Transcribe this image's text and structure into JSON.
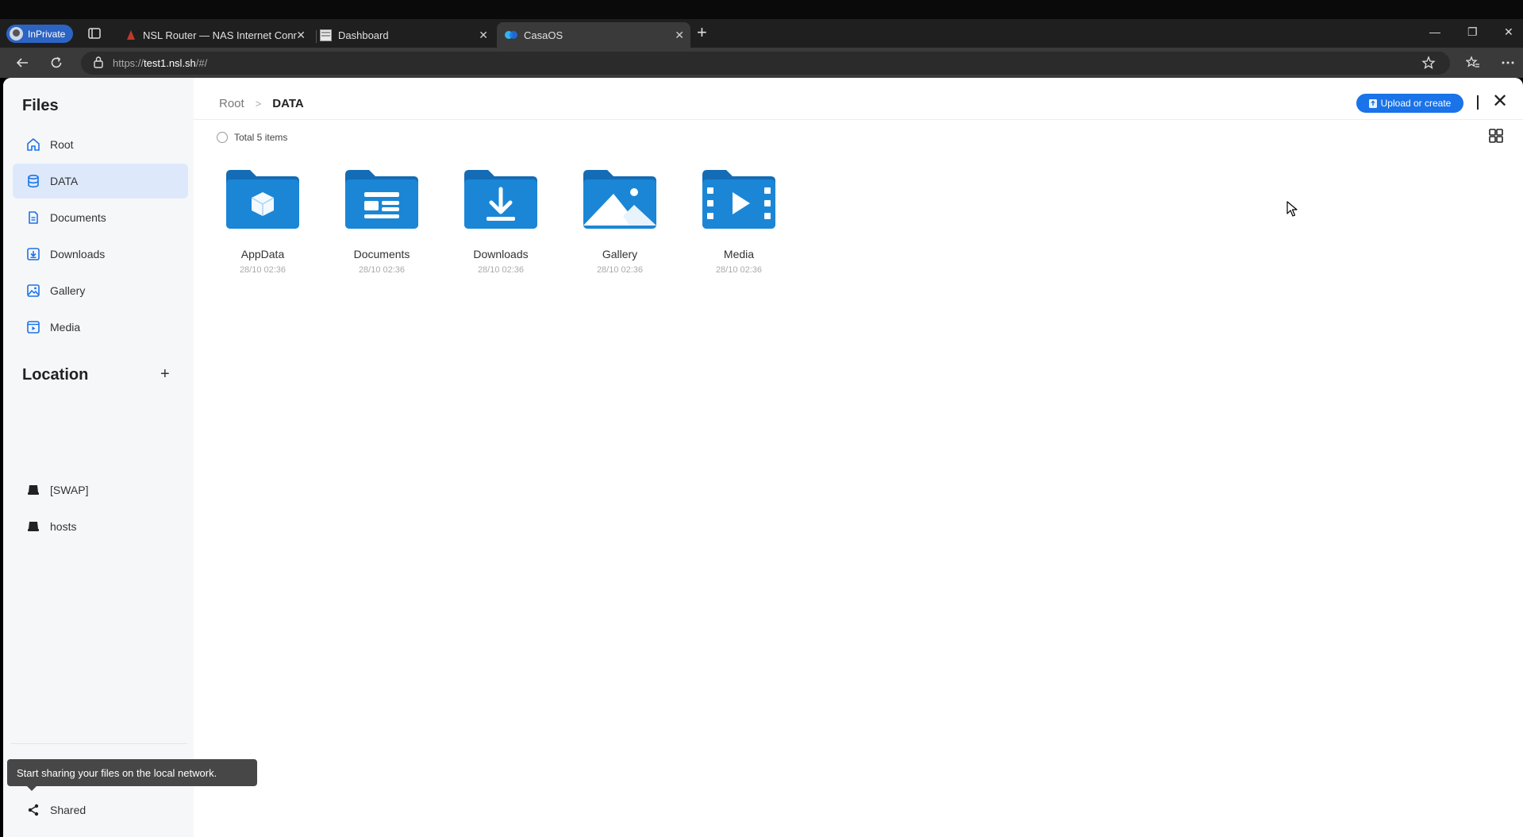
{
  "browser": {
    "inprivate_label": "InPrivate",
    "tabs": [
      {
        "label": "NSL Router — NAS Internet Conr",
        "icon": "router-favicon"
      },
      {
        "label": "Dashboard",
        "icon": "dashboard-favicon"
      },
      {
        "label": "CasaOS",
        "icon": "casaos-favicon",
        "active": true
      }
    ],
    "url_prefix": "https://",
    "url_host": "test1.nsl.sh",
    "url_path": "/#/"
  },
  "sidebar": {
    "title": "Files",
    "items": [
      {
        "label": "Root",
        "icon": "home-icon"
      },
      {
        "label": "DATA",
        "icon": "database-icon",
        "active": true
      },
      {
        "label": "Documents",
        "icon": "document-icon"
      },
      {
        "label": "Downloads",
        "icon": "download-icon"
      },
      {
        "label": "Gallery",
        "icon": "image-icon"
      },
      {
        "label": "Media",
        "icon": "video-icon"
      }
    ],
    "location_title": "Location",
    "locations": [
      {
        "label": "[SWAP]",
        "icon": "drive-icon"
      },
      {
        "label": "hosts",
        "icon": "drive-icon"
      }
    ],
    "tooltip": "Start sharing your files on the local network.",
    "shared_label": "Shared"
  },
  "main": {
    "breadcrumb": [
      "Root",
      "DATA"
    ],
    "breadcrumb_sep": ">",
    "upload_label": "Upload or create",
    "total_label": "Total 5 items",
    "folders": [
      {
        "name": "AppData",
        "date": "28/10 02:36",
        "icon": "cube-folder-icon"
      },
      {
        "name": "Documents",
        "date": "28/10 02:36",
        "icon": "document-folder-icon"
      },
      {
        "name": "Downloads",
        "date": "28/10 02:36",
        "icon": "download-folder-icon"
      },
      {
        "name": "Gallery",
        "date": "28/10 02:36",
        "icon": "gallery-folder-icon"
      },
      {
        "name": "Media",
        "date": "28/10 02:36",
        "icon": "media-folder-icon"
      }
    ]
  },
  "colors": {
    "accent": "#1a73e8",
    "folder_blue": "#1b86d6",
    "folder_blue_dark": "#136cb5",
    "active_bg": "#dde9fb"
  }
}
